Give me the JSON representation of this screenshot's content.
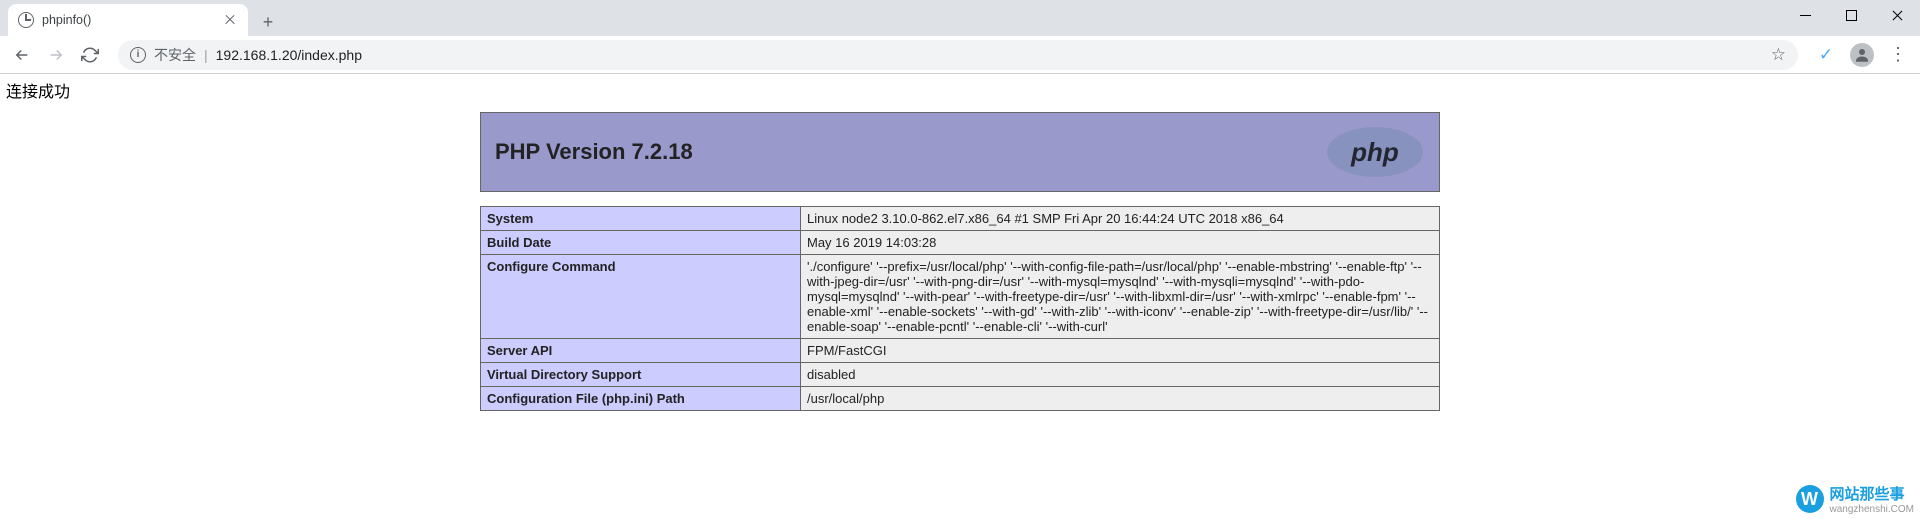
{
  "browser": {
    "tab_title": "phpinfo()",
    "security_label": "不安全",
    "url": "192.168.1.20/index.php"
  },
  "page": {
    "connection_msg": "连接成功",
    "php_version_header": "PHP Version 7.2.18",
    "rows": [
      {
        "key": "System",
        "value": "Linux node2 3.10.0-862.el7.x86_64 #1 SMP Fri Apr 20 16:44:24 UTC 2018 x86_64"
      },
      {
        "key": "Build Date",
        "value": "May 16 2019 14:03:28"
      },
      {
        "key": "Configure Command",
        "value": "'./configure' '--prefix=/usr/local/php' '--with-config-file-path=/usr/local/php' '--enable-mbstring' '--enable-ftp' '--with-jpeg-dir=/usr' '--with-png-dir=/usr' '--with-mysql=mysqlnd' '--with-mysqli=mysqlnd' '--with-pdo-mysql=mysqlnd' '--with-pear' '--with-freetype-dir=/usr' '--with-libxml-dir=/usr' '--with-xmlrpc' '--enable-fpm' '--enable-xml' '--enable-sockets' '--with-gd' '--with-zlib' '--with-iconv' '--enable-zip' '--with-freetype-dir=/usr/lib/' '--enable-soap' '--enable-pcntl' '--enable-cli' '--with-curl'"
      },
      {
        "key": "Server API",
        "value": "FPM/FastCGI"
      },
      {
        "key": "Virtual Directory Support",
        "value": "disabled"
      },
      {
        "key": "Configuration File (php.ini) Path",
        "value": "/usr/local/php"
      }
    ]
  },
  "watermark": {
    "line1": "网站那些事",
    "line2": "wangzhenshi.COM"
  }
}
